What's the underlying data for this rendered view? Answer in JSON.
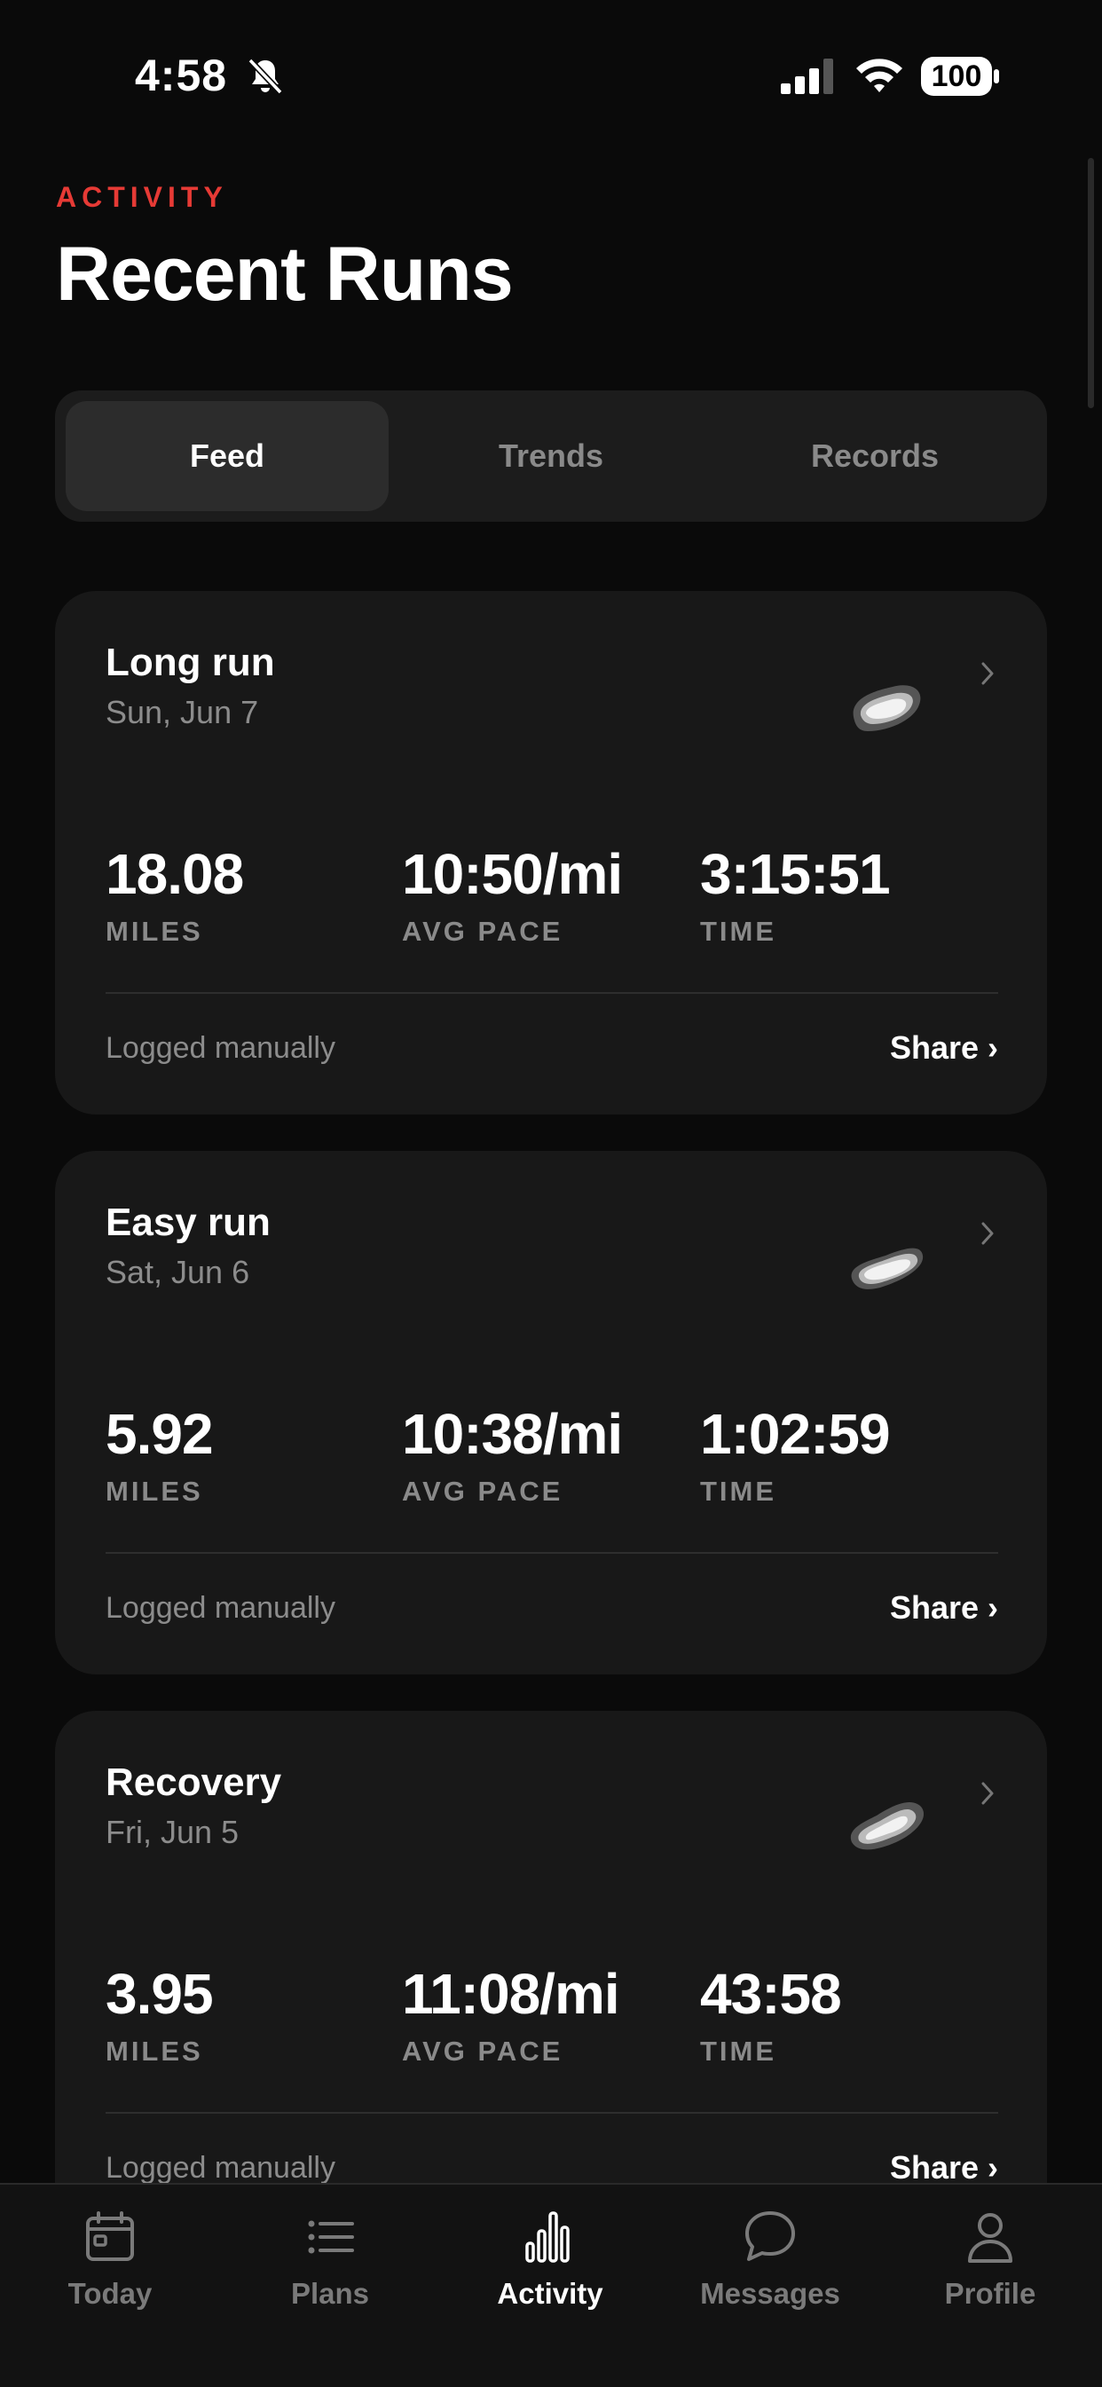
{
  "status_bar": {
    "time": "4:58",
    "battery": "100"
  },
  "header": {
    "section_label": "ACTIVITY",
    "title": "Recent Runs"
  },
  "segments": [
    {
      "label": "Feed",
      "active": true
    },
    {
      "label": "Trends",
      "active": false
    },
    {
      "label": "Records",
      "active": false
    }
  ],
  "runs": [
    {
      "title": "Long run",
      "date": "Sun, Jun 7",
      "stats": [
        {
          "value": "18.08",
          "label": "MILES"
        },
        {
          "value": "10:50/mi",
          "label": "AVG PACE"
        },
        {
          "value": "3:15:51",
          "label": "TIME"
        }
      ],
      "note": "Logged manually",
      "share_label": "Share ›"
    },
    {
      "title": "Easy run",
      "date": "Sat, Jun 6",
      "stats": [
        {
          "value": "5.92",
          "label": "MILES"
        },
        {
          "value": "10:38/mi",
          "label": "AVG PACE"
        },
        {
          "value": "1:02:59",
          "label": "TIME"
        }
      ],
      "note": "Logged manually",
      "share_label": "Share ›"
    },
    {
      "title": "Recovery",
      "date": "Fri, Jun 5",
      "stats": [
        {
          "value": "3.95",
          "label": "MILES"
        },
        {
          "value": "11:08/mi",
          "label": "AVG PACE"
        },
        {
          "value": "43:58",
          "label": "TIME"
        }
      ],
      "note": "Logged manually",
      "share_label": "Share ›"
    }
  ],
  "tab_bar": [
    {
      "label": "Today",
      "icon": "calendar-icon",
      "active": false
    },
    {
      "label": "Plans",
      "icon": "list-icon",
      "active": false
    },
    {
      "label": "Activity",
      "icon": "bar-chart-icon",
      "active": true
    },
    {
      "label": "Messages",
      "icon": "chat-bubble-icon",
      "active": false
    },
    {
      "label": "Profile",
      "icon": "person-icon",
      "active": false
    }
  ],
  "colors": {
    "accent": "#e63a35",
    "background": "#0a0a0a",
    "card": "#181818"
  }
}
